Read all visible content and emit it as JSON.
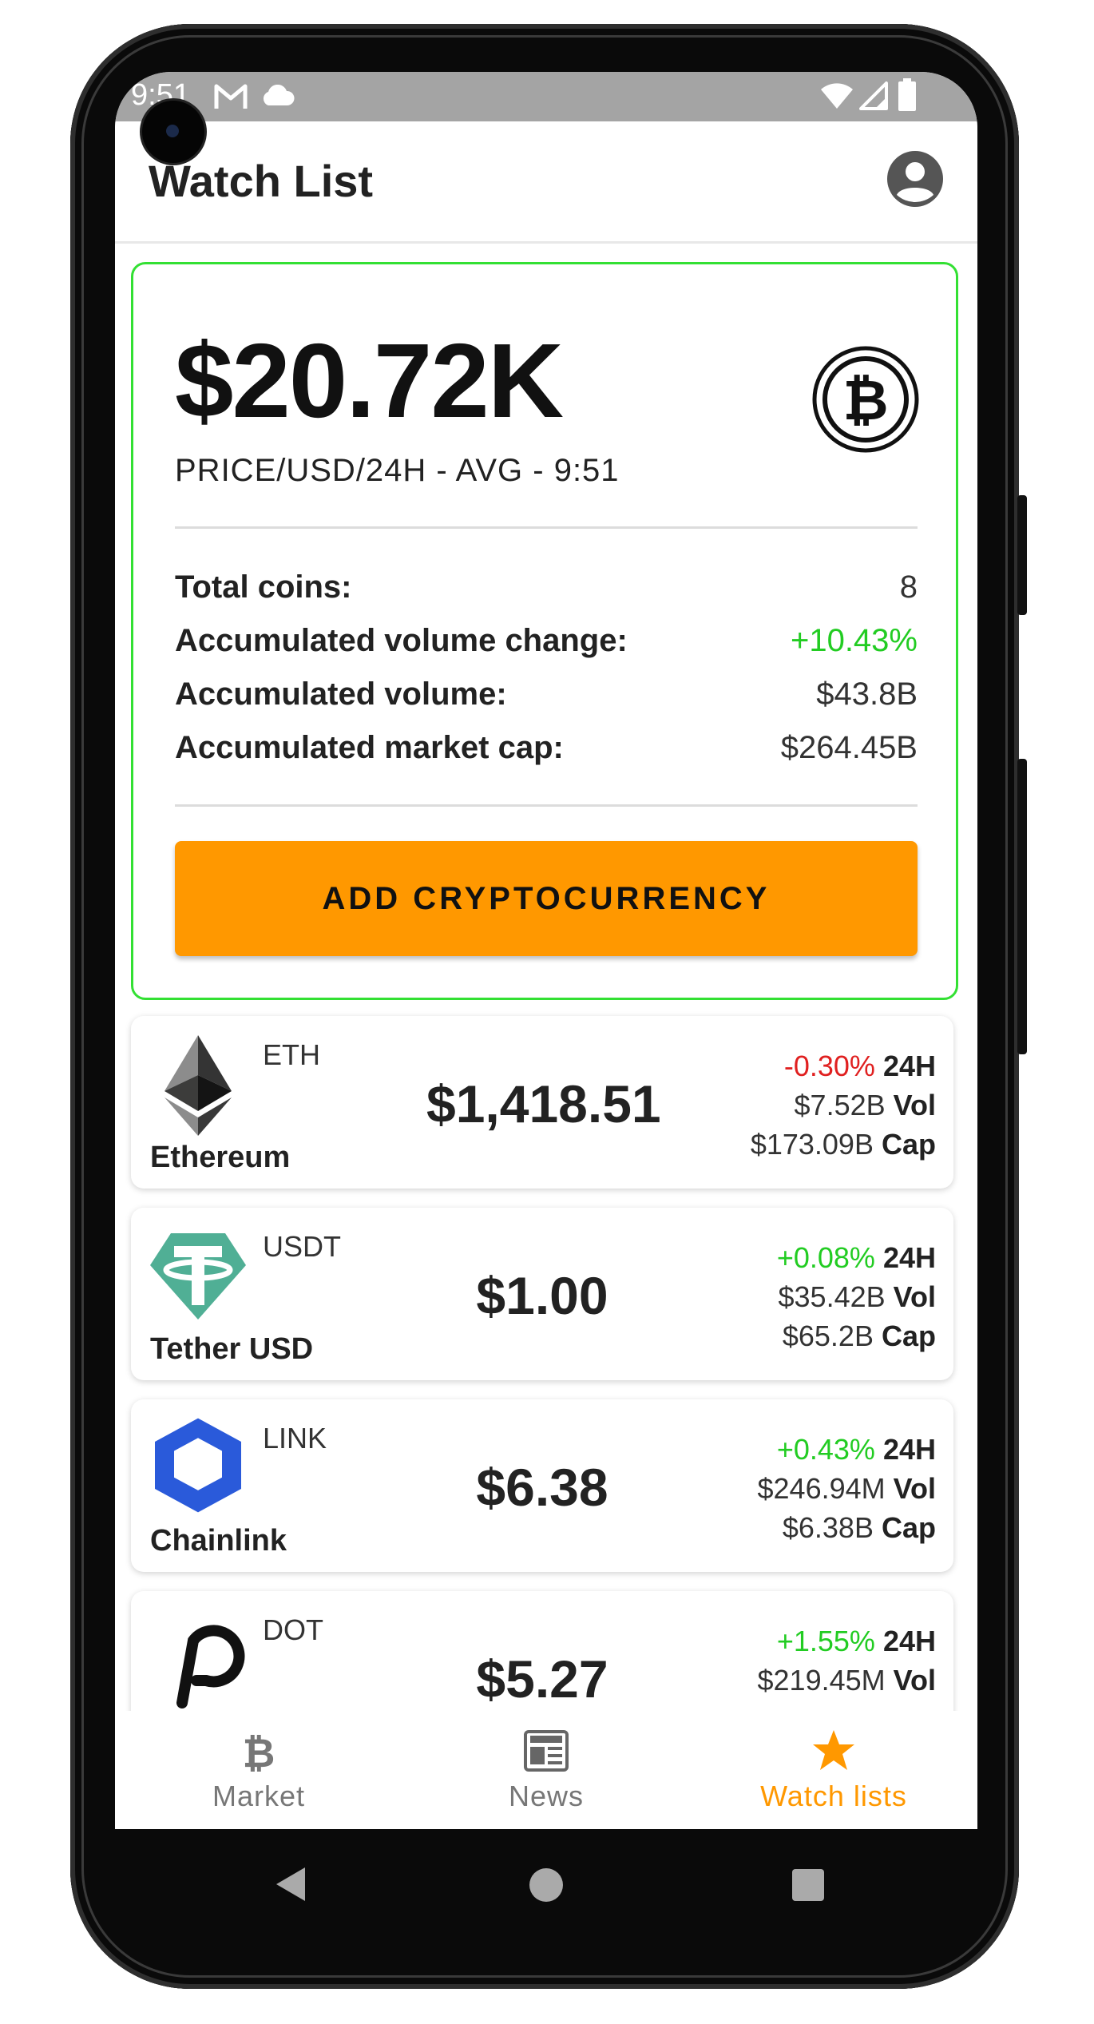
{
  "status_bar": {
    "time": "9:51"
  },
  "app_bar": {
    "title": "Watch List"
  },
  "summary": {
    "price": "$20.72K",
    "subtitle": "PRICE/USD/24H - AVG - 9:51",
    "stats": [
      {
        "label": "Total coins:",
        "value": "8"
      },
      {
        "label": "Accumulated volume change:",
        "value": "+10.43%"
      },
      {
        "label": "Accumulated volume:",
        "value": "$43.8B"
      },
      {
        "label": "Accumulated market cap:",
        "value": "$264.45B"
      }
    ],
    "add_button": "ADD CRYPTOCURRENCY"
  },
  "coins": [
    {
      "symbol": "ETH",
      "name": "Ethereum",
      "price": "$1,418.51",
      "change": "-0.30%",
      "change_label": "24H",
      "volume": "$7.52B",
      "volume_label": "Vol",
      "cap": "$173.09B",
      "cap_label": "Cap"
    },
    {
      "symbol": "USDT",
      "name": "Tether USD",
      "price": "$1.00",
      "change": "+0.08%",
      "change_label": "24H",
      "volume": "$35.42B",
      "volume_label": "Vol",
      "cap": "$65.2B",
      "cap_label": "Cap"
    },
    {
      "symbol": "LINK",
      "name": "Chainlink",
      "price": "$6.38",
      "change": "+0.43%",
      "change_label": "24H",
      "volume": "$246.94M",
      "volume_label": "Vol",
      "cap": "$6.38B",
      "cap_label": "Cap"
    },
    {
      "symbol": "DOT",
      "name": "",
      "price": "$5.27",
      "change": "+1.55%",
      "change_label": "24H",
      "volume": "$219.45M",
      "volume_label": "Vol"
    }
  ],
  "bottom_nav": [
    {
      "label": "Market",
      "icon": "bitcoin-icon"
    },
    {
      "label": "News",
      "icon": "newspaper-icon"
    },
    {
      "label": "Watch lists",
      "icon": "star-icon",
      "active": true
    }
  ],
  "colors": {
    "accent": "#ff9800",
    "positive": "#22cc22",
    "negative": "#e02020",
    "card_border": "#33e033"
  }
}
